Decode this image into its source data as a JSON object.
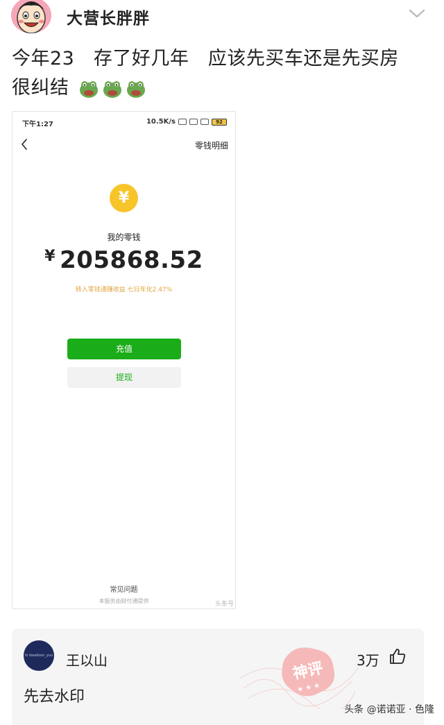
{
  "post": {
    "author": "大营长胖胖",
    "line1": "今年23　存了好几年　应该先买车还是先买房",
    "line2": "很纠结",
    "emojis": [
      "frog-face-icon",
      "frog-face-icon",
      "frog-face-icon"
    ]
  },
  "screenshot": {
    "status": {
      "time": "下午1:27",
      "net_speed": "10.5K/s",
      "battery": "92"
    },
    "nav": {
      "detail_label": "零钱明细"
    },
    "coin_symbol": "¥",
    "balance_label": "我的零钱",
    "currency": "¥",
    "balance": "205868.52",
    "interest_note": "转入零钱通赚收益 七日年化2.47%",
    "recharge_label": "充值",
    "withdraw_label": "提现",
    "faq_label": "常见问题",
    "provider_note": "本服务由财付通提供",
    "watermark": "头条号"
  },
  "comment": {
    "avatar_text": "hi ikealloon_yuu",
    "user": "王以山",
    "likes": "3万",
    "stamp_text": "神评",
    "text": "先去水印"
  },
  "footer": {
    "credit": "头条 @诺诺亚 · 色隆"
  },
  "colors": {
    "wechat_green": "#1aad19",
    "coin_yellow": "#f7c42a",
    "interest_orange": "#e0a640"
  }
}
